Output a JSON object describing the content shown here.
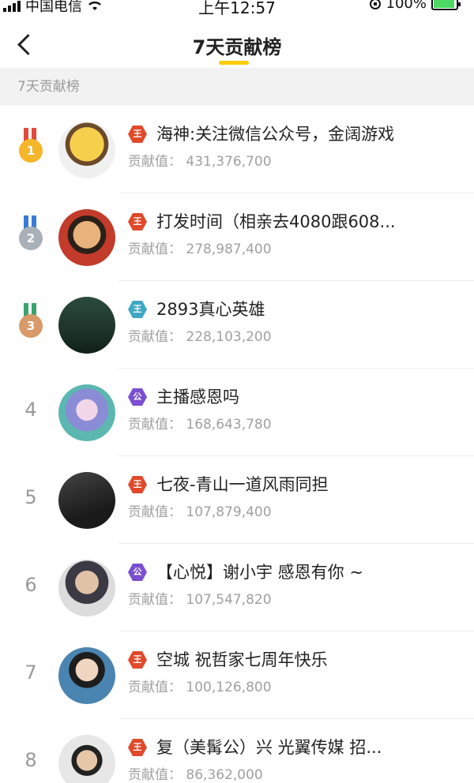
{
  "status_bar": {
    "carrier": "中国电信",
    "time": "上午12:57",
    "battery": "100%"
  },
  "nav": {
    "title": "7天贡献榜"
  },
  "section": {
    "title": "7天贡献榜"
  },
  "contribution_label": "贡献值：",
  "rows": [
    {
      "rank": "1",
      "medal": "gold",
      "badge": "王",
      "badge_color": "#e04a2a",
      "name": "海神:关注微信公众号，金阔游戏",
      "value": "431,376,700",
      "avatar_icon": "raccoon-avatar"
    },
    {
      "rank": "2",
      "medal": "silver",
      "badge": "王",
      "badge_color": "#e04a2a",
      "name": "打发时间（相亲去4080跟608...",
      "value": "278,987,400",
      "avatar_icon": "anime-avatar"
    },
    {
      "rank": "3",
      "medal": "bronze",
      "badge": "王",
      "badge_color": "#3fa8c4",
      "name": "2893真心英雄",
      "value": "228,103,200",
      "avatar_icon": "poster-avatar"
    },
    {
      "rank": "4",
      "medal": "",
      "badge": "公",
      "badge_color": "#7b4fd0",
      "name": "主播感恩吗",
      "value": "168,643,780",
      "avatar_icon": "mermaid-avatar"
    },
    {
      "rank": "5",
      "medal": "",
      "badge": "王",
      "badge_color": "#e04a2a",
      "name": "七夜-青山一道风雨同担",
      "value": "107,879,400",
      "avatar_icon": "person-avatar"
    },
    {
      "rank": "6",
      "medal": "",
      "badge": "公",
      "badge_color": "#7b4fd0",
      "name": "【心悦】谢小宇 感恩有你 ~",
      "value": "107,547,820",
      "avatar_icon": "person-avatar"
    },
    {
      "rank": "7",
      "medal": "",
      "badge": "王",
      "badge_color": "#e04a2a",
      "name": "空城 祝哲家七周年快乐",
      "value": "100,126,800",
      "avatar_icon": "person-avatar"
    },
    {
      "rank": "8",
      "medal": "",
      "badge": "王",
      "badge_color": "#e04a2a",
      "name": "复（美髯公）兴 光翼传媒 招...",
      "value": "86,362,000",
      "avatar_icon": "person-avatar"
    }
  ]
}
